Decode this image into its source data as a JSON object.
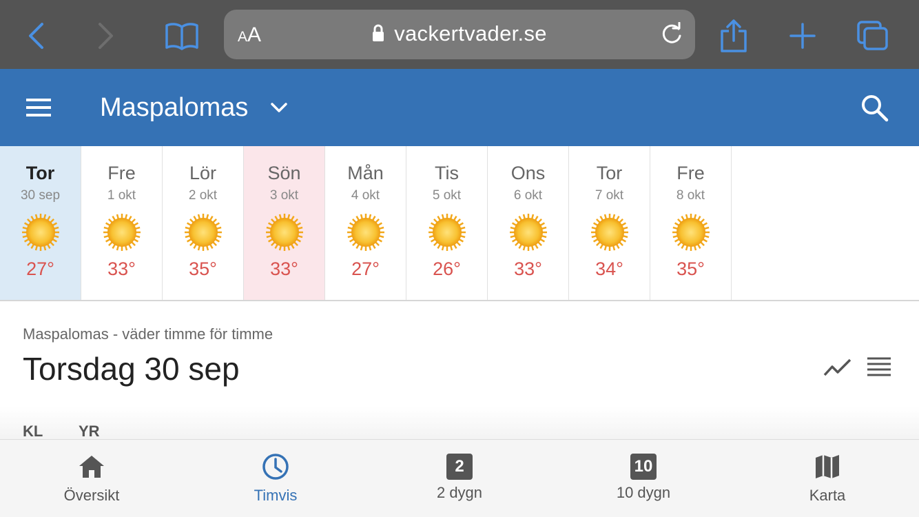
{
  "browser": {
    "text_size_label_small": "A",
    "text_size_label_large": "A",
    "url": "vackertvader.se"
  },
  "header": {
    "city": "Maspalomas"
  },
  "days": [
    {
      "name": "Tor",
      "date": "30 sep",
      "temp": "27°",
      "state": "active"
    },
    {
      "name": "Fre",
      "date": "1 okt",
      "temp": "33°",
      "state": ""
    },
    {
      "name": "Lör",
      "date": "2 okt",
      "temp": "35°",
      "state": ""
    },
    {
      "name": "Sön",
      "date": "3 okt",
      "temp": "33°",
      "state": "sunday"
    },
    {
      "name": "Mån",
      "date": "4 okt",
      "temp": "27°",
      "state": ""
    },
    {
      "name": "Tis",
      "date": "5 okt",
      "temp": "26°",
      "state": ""
    },
    {
      "name": "Ons",
      "date": "6 okt",
      "temp": "33°",
      "state": ""
    },
    {
      "name": "Tor",
      "date": "7 okt",
      "temp": "34°",
      "state": ""
    },
    {
      "name": "Fre",
      "date": "8 okt",
      "temp": "35°",
      "state": ""
    }
  ],
  "main": {
    "subtitle": "Maspalomas - väder timme för timme",
    "date_title": "Torsdag 30 sep",
    "col_kl": "KL",
    "col_yr": "YR"
  },
  "nav": {
    "overview": "Översikt",
    "hourly": "Timvis",
    "two_days_badge": "2",
    "two_days": "2 dygn",
    "ten_days_badge": "10",
    "ten_days": "10 dygn",
    "map": "Karta"
  },
  "colors": {
    "accent": "#3572b5",
    "temp": "#d9534f",
    "active_day_bg": "#dbeaf6",
    "sunday_bg": "#fbe6ea"
  }
}
